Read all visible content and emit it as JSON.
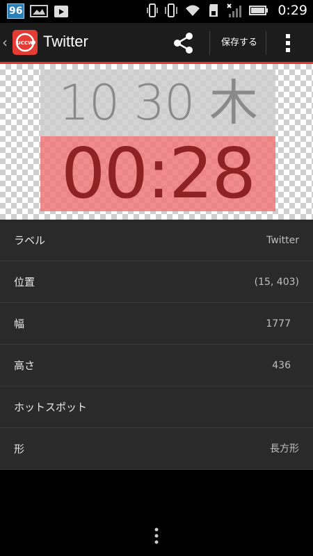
{
  "status_bar": {
    "notification_count": "96",
    "time": "0:29"
  },
  "action_bar": {
    "title": "Twitter",
    "logo_text": "UCCW",
    "save_label": "保存する"
  },
  "preview": {
    "date_line": "10 30 木",
    "time_line": "00:28"
  },
  "properties": [
    {
      "label": "ラベル",
      "value": "Twitter"
    },
    {
      "label": "位置",
      "value": "(15, 403)"
    },
    {
      "label": "幅",
      "value": "1777"
    },
    {
      "label": "高さ",
      "value": "436"
    },
    {
      "label": "ホットスポット",
      "value": ""
    },
    {
      "label": "形",
      "value": "長方形"
    }
  ],
  "colors": {
    "accent": "#e0342c",
    "date_bg": "#cdcdcd",
    "time_bg": "#f07878"
  }
}
